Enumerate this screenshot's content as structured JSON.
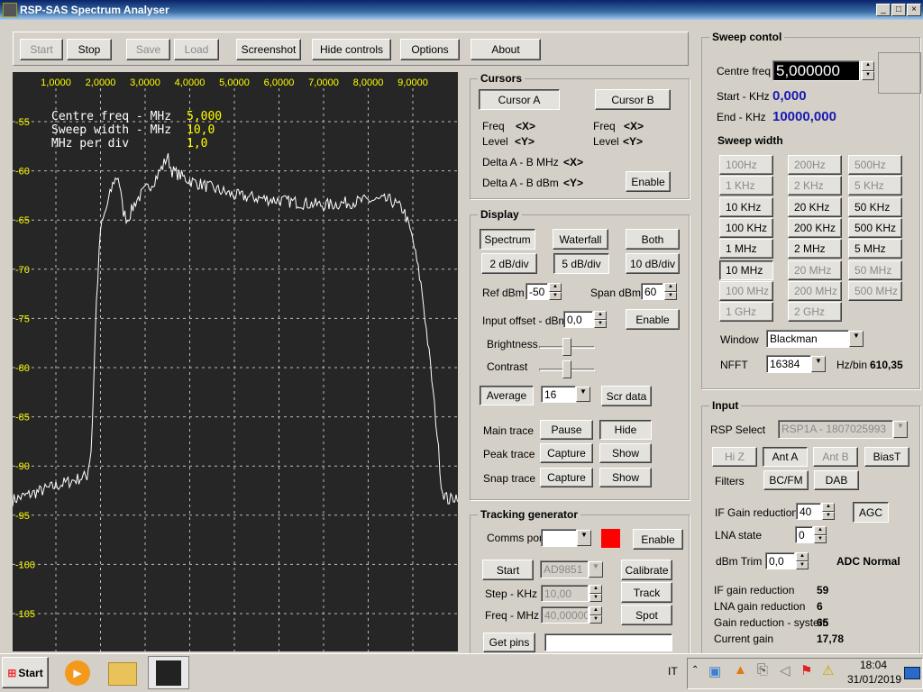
{
  "window": {
    "title": "RSP-SAS Spectrum Analyser",
    "min": "_",
    "max": "□",
    "close": "×"
  },
  "toolbar": {
    "start": "Start",
    "stop": "Stop",
    "save": "Save",
    "load": "Load",
    "screenshot": "Screenshot",
    "hide_controls": "Hide controls",
    "options": "Options",
    "about": "About"
  },
  "plot": {
    "x_ticks": [
      "1,0000",
      "2,0000",
      "3,0000",
      "4,0000",
      "5,0000",
      "6,0000",
      "7,0000",
      "8,0000",
      "9,0000"
    ],
    "y_ticks": [
      "-55",
      "-60",
      "-65",
      "-70",
      "-75",
      "-80",
      "-85",
      "-90",
      "-95",
      "-100",
      "-105"
    ],
    "info": [
      {
        "label": "Centre freq - MHz",
        "value": "5,000"
      },
      {
        "label": "Sweep width - MHz",
        "value": "10,0"
      },
      {
        "label": "MHz per div",
        "value": "1,0"
      }
    ],
    "trace_color": "#ffffff",
    "tick_color": "#ffff00"
  },
  "chart_data": {
    "type": "line",
    "xlim": [
      0,
      10
    ],
    "ylim": [
      -110,
      -50
    ],
    "x_unit": "MHz",
    "y_unit": "dBm",
    "grid": true,
    "x": [
      0,
      1.7,
      1.8,
      1.9,
      2.0,
      2.3,
      2.4,
      2.5,
      2.6,
      2.8,
      3.0,
      3.2,
      3.4,
      3.5,
      3.6,
      4.0,
      5.0,
      6.0,
      7.0,
      8.0,
      8.5,
      8.8,
      9.0,
      9.2,
      9.4,
      9.55,
      9.65,
      9.8,
      10
    ],
    "y": [
      -93.5,
      -91,
      -88,
      -74,
      -66,
      -61,
      -60.5,
      -64,
      -65,
      -63,
      -62,
      -61,
      -59.5,
      -58.5,
      -60,
      -61,
      -62.5,
      -63,
      -63.5,
      -63,
      -63,
      -64,
      -67,
      -72,
      -80,
      -87,
      -92.5,
      -93.5,
      -93
    ]
  },
  "cursors": {
    "title": "Cursors",
    "cursor_a": "Cursor A",
    "cursor_b": "Cursor B",
    "freq": "Freq",
    "level": "Level",
    "x": "<X>",
    "y": "<Y>",
    "delta_mhz": "Delta A - B MHz",
    "delta_dbm": "Delta A - B dBm",
    "enable": "Enable"
  },
  "display": {
    "title": "Display",
    "spectrum": "Spectrum",
    "waterfall": "Waterfall",
    "both": "Both",
    "div2": "2 dB/div",
    "div5": "5 dB/div",
    "div10": "10 dB/div",
    "ref_label": "Ref dBm",
    "ref": "-50",
    "span_label": "Span dBm",
    "span": "60",
    "offset_label": "Input offset - dBm",
    "offset": "0,0",
    "enable": "Enable",
    "brightness": "Brightness",
    "brightness_level": 0.5,
    "contrast": "Contrast",
    "contrast_level": 0.5,
    "average": "Average",
    "average_value": "16",
    "scr_data": "Scr data",
    "main_trace": "Main trace",
    "pause": "Pause",
    "hide": "Hide",
    "peak_trace": "Peak trace",
    "capture": "Capture",
    "show": "Show",
    "snap_trace": "Snap trace"
  },
  "tracking": {
    "title": "Tracking generator",
    "comms_port": "Comms port",
    "comms_value": "",
    "status_color": "#ff0000",
    "enable": "Enable",
    "start": "Start",
    "chip": "AD9851",
    "calibrate": "Calibrate",
    "step_label": "Step - KHz",
    "step": "10,00",
    "track": "Track",
    "freq_label": "Freq - MHz",
    "freq": "40,000000",
    "spot": "Spot",
    "get_pins": "Get pins",
    "pins_value": ""
  },
  "sweep": {
    "title": "Sweep contol",
    "centre_label": "Centre freq",
    "centre": "5,000000",
    "start_label": "Start - KHz",
    "start": "0,000",
    "end_label": "End - KHz",
    "end": "10000,000",
    "width_title": "Sweep width",
    "widths": [
      {
        "label": "100Hz",
        "enabled": false
      },
      {
        "label": "200Hz",
        "enabled": false
      },
      {
        "label": "500Hz",
        "enabled": false
      },
      {
        "label": "1 KHz",
        "enabled": false
      },
      {
        "label": "2 KHz",
        "enabled": false
      },
      {
        "label": "5 KHz",
        "enabled": false
      },
      {
        "label": "10 KHz",
        "enabled": true
      },
      {
        "label": "20 KHz",
        "enabled": true
      },
      {
        "label": "50 KHz",
        "enabled": true
      },
      {
        "label": "100 KHz",
        "enabled": true
      },
      {
        "label": "200 KHz",
        "enabled": true
      },
      {
        "label": "500 KHz",
        "enabled": true
      },
      {
        "label": "1 MHz",
        "enabled": true
      },
      {
        "label": "2 MHz",
        "enabled": true
      },
      {
        "label": "5 MHz",
        "enabled": true
      },
      {
        "label": "10 MHz",
        "enabled": true,
        "selected": true
      },
      {
        "label": "20 MHz",
        "enabled": false
      },
      {
        "label": "50 MHz",
        "enabled": false
      },
      {
        "label": "100 MHz",
        "enabled": false
      },
      {
        "label": "200 MHz",
        "enabled": false
      },
      {
        "label": "500 MHz",
        "enabled": false
      },
      {
        "label": "1 GHz",
        "enabled": false
      },
      {
        "label": "2 GHz",
        "enabled": false
      }
    ],
    "window_label": "Window",
    "window": "Blackman",
    "nfft_label": "NFFT",
    "nfft": "16384",
    "hzbin_label": "Hz/bin",
    "hzbin": "610,35"
  },
  "input": {
    "title": "Input",
    "rsp_label": "RSP Select",
    "rsp": "RSP1A - 1807025993",
    "hiz": "Hi Z",
    "ant_a": "Ant A",
    "ant_b": "Ant B",
    "biast": "BiasT",
    "filters": "Filters",
    "bcfm": "BC/FM",
    "dab": "DAB",
    "if_label": "IF Gain reduction",
    "if_value": "40",
    "agc": "AGC",
    "lna_label": "LNA state",
    "lna_value": "0",
    "trim_label": "dBm Trim",
    "trim_value": "0,0",
    "adc": "ADC Normal",
    "stats": [
      {
        "label": "IF gain reduction",
        "value": "59"
      },
      {
        "label": "LNA gain reduction",
        "value": "6"
      },
      {
        "label": "Gain reduction - system",
        "value": "65"
      },
      {
        "label": "Current gain",
        "value": "17,78"
      }
    ]
  },
  "taskbar": {
    "start": "Start",
    "lang": "IT",
    "time": "18:04",
    "date": "31/01/2019"
  }
}
